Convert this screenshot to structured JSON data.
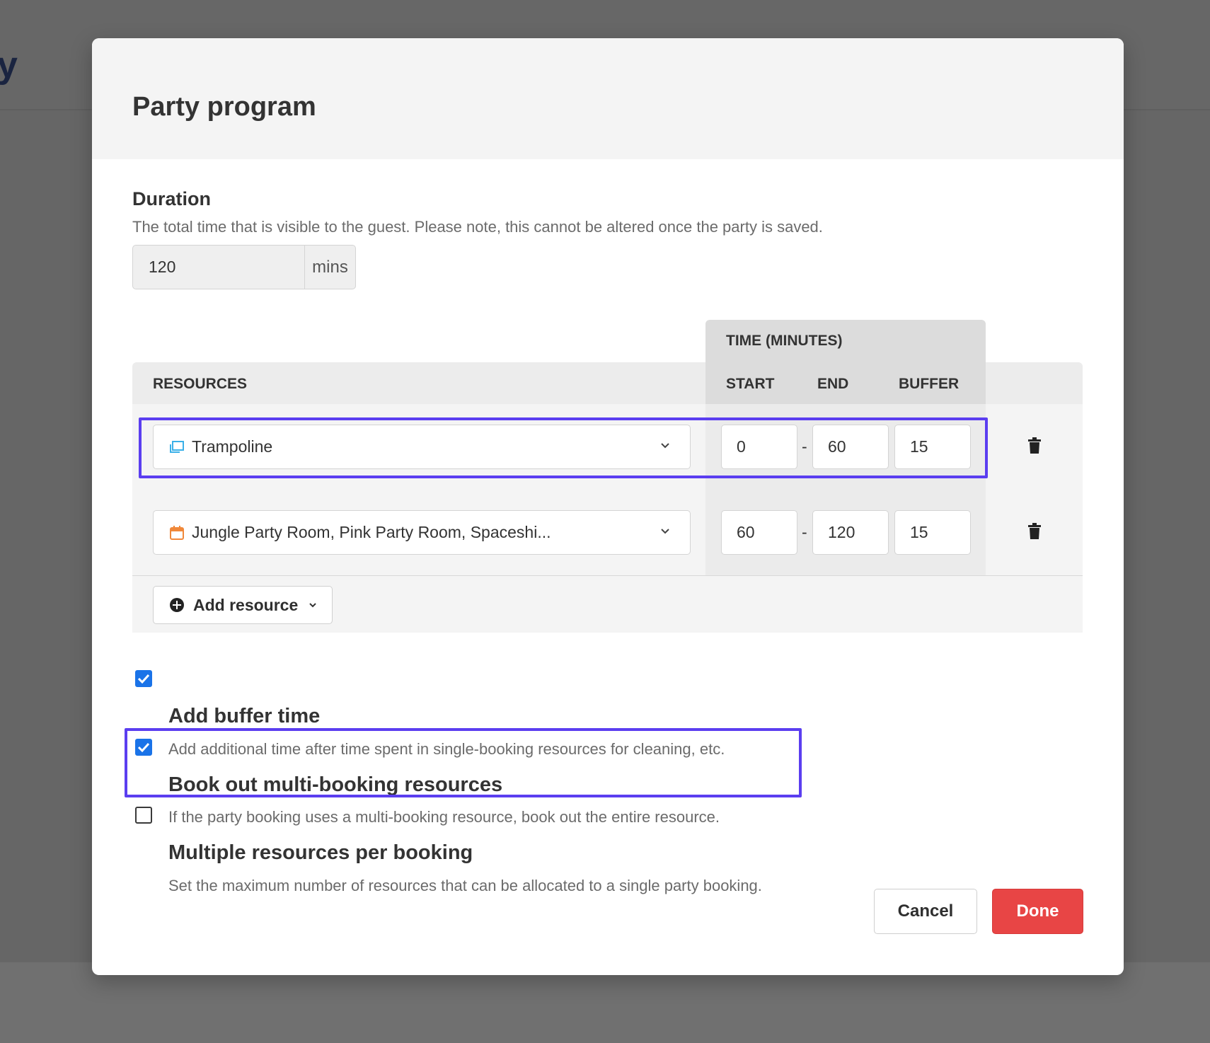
{
  "background": {
    "logo_fragment": "y"
  },
  "modal": {
    "title": "Party program",
    "duration": {
      "title": "Duration",
      "description": "The total time that is visible to the guest. Please note, this cannot be altered once the party is saved.",
      "value": "120",
      "unit": "mins"
    },
    "table": {
      "time_group_label": "TIME (MINUTES)",
      "columns": {
        "resources": "RESOURCES",
        "start": "START",
        "end": "END",
        "buffer": "BUFFER"
      },
      "rows": [
        {
          "resource": "Trampoline",
          "icon": "window-icon",
          "icon_color": "#3ab0e8",
          "start": "0",
          "end": "60",
          "buffer": "15",
          "separator": "-"
        },
        {
          "resource": "Jungle Party Room, Pink Party Room, Spaceshi...",
          "icon": "calendar-icon",
          "icon_color": "#f0883a",
          "start": "60",
          "end": "120",
          "buffer": "15",
          "separator": "-"
        }
      ],
      "add_resource_label": "Add resource"
    },
    "options": [
      {
        "title": "Add buffer time",
        "description": "Add additional time after time spent in single-booking resources for cleaning, etc.",
        "checked": true
      },
      {
        "title": "Book out multi-booking resources",
        "description": "If the party booking uses a multi-booking resource, book out the entire resource.",
        "checked": true
      },
      {
        "title": "Multiple resources per booking",
        "description": "Set the maximum number of resources that can be allocated to a single party booking.",
        "checked": false
      }
    ],
    "buttons": {
      "cancel": "Cancel",
      "done": "Done"
    }
  },
  "colors": {
    "accent_blue": "#1a73e8",
    "highlight": "#5b3ef0",
    "done_red": "#e84545"
  }
}
